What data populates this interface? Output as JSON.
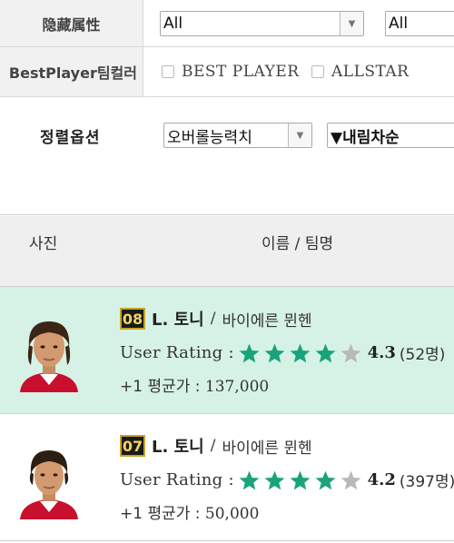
{
  "filters": {
    "hidden_attr": {
      "label": "隐藏属性",
      "select1_value": "All",
      "select2_value": "All"
    },
    "best_player_team_color": {
      "label": "BestPlayer팀컬러",
      "options": [
        "BEST PLAYER",
        "ALLSTAR"
      ]
    },
    "sort": {
      "label": "정렬옵션",
      "by_value": "오버롤능력치",
      "order_value": "▼내림차순"
    }
  },
  "table": {
    "headers": {
      "photo": "사진",
      "name_team": "이름 / 팀명"
    }
  },
  "players": [
    {
      "grade": "08",
      "name": "L. 토니",
      "separator": "/",
      "team": "바이에른 뮌헨",
      "rating_label": "User Rating",
      "rating_colon": ":",
      "rating": "4.3",
      "rating_value": 4.3,
      "votes": "(52명)",
      "price_label": "+1 평균가 :",
      "price": "137,000",
      "highlighted": true
    },
    {
      "grade": "07",
      "name": "L. 토니",
      "separator": "/",
      "team": "바이에른 뮌헨",
      "rating_label": "User Rating",
      "rating_colon": ":",
      "rating": "4.2",
      "rating_value": 4.2,
      "votes": "(397명)",
      "price_label": "+1 평균가 :",
      "price": "50,000",
      "highlighted": false
    }
  ],
  "colors": {
    "star_filled": "#1aa37a",
    "star_empty": "#b9b9b9",
    "highlight_row": "#d6f2e6",
    "grade_border": "#c9a227"
  }
}
